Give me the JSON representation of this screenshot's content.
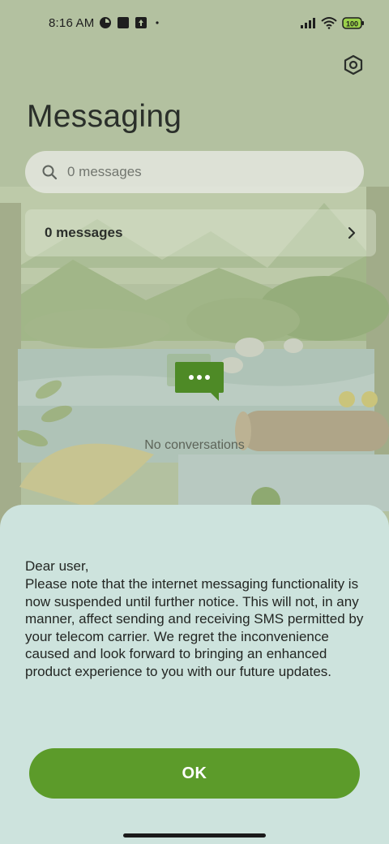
{
  "status_bar": {
    "time": "8:16 AM",
    "battery_level": "100",
    "icons": [
      "vpn-key-icon",
      "stop-square-icon",
      "upload-arrow-icon",
      "dot-icon",
      "signal-icon",
      "wifi-icon",
      "battery-icon"
    ]
  },
  "app": {
    "title": "Messaging",
    "settings_icon": "gear-hexagon-icon",
    "search": {
      "placeholder": "0 messages",
      "icon": "search-icon"
    },
    "messages_row": {
      "label": "0 messages",
      "icon": "chevron-right-icon"
    },
    "empty_state": {
      "label": "No conversations",
      "icon": "chat-bubbles-icon"
    }
  },
  "dialog": {
    "greeting": "Dear user,",
    "body": "Please note that the internet messaging functionality is now suspended until further notice. This will not, in any manner, affect sending and receiving SMS permitted by your telecom carrier. We regret the inconvenience caused and look forward to bringing an enhanced product experience to you with our future updates.",
    "ok_label": "OK"
  },
  "colors": {
    "accent": "#5c9b2a",
    "sheet_background": "#cde3dd",
    "empty_icon": "#4e8a26"
  }
}
